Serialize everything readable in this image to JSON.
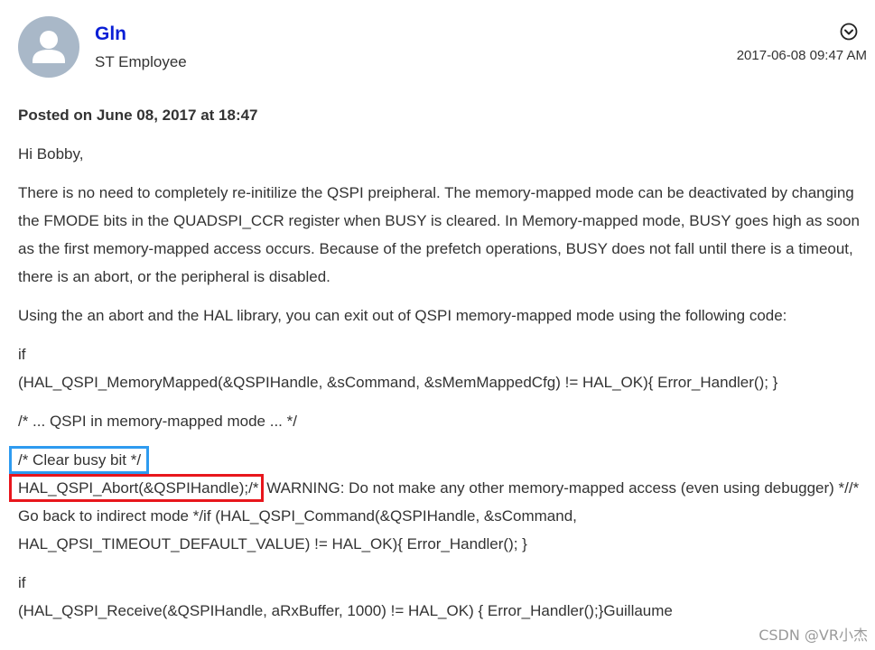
{
  "author": {
    "name": "Gln",
    "role": "ST Employee",
    "avatar_icon": "user-avatar-icon"
  },
  "post": {
    "date": "2017-06-08 09:47 AM",
    "options_icon": "chevron-down-circle-icon",
    "posted_on": "Posted on June 08, 2017 at 18:47",
    "greeting": "Hi Bobby,",
    "para1": "There is no need to completely re-initilize the QSPI preipheral. The memory-mapped mode can be deactivated by changing the FMODE bits in the QUADSPI_CCR register when BUSY is cleared. In Memory-mapped mode, BUSY goes high as soon as the first memory-mapped access occurs. Because of the prefetch operations, BUSY does not fall until there is a timeout, there is an abort, or the peripheral is disabled.",
    "para2": "Using the an abort and the HAL library, you can exit out of QSPI memory-mapped mode using the following code:",
    "code1_if": "if",
    "code1_call": "(HAL_QSPI_MemoryMapped(&QSPIHandle, &sCommand, &sMemMappedCfg) != HAL_OK){   Error_Handler(); }",
    "comment1": "/* ... QSPI in memory-mapped mode ... */",
    "clear_busy": "/* Clear busy bit */",
    "abort_call": "HAL_QSPI_Abort(&QSPIHandle);/*",
    "abort_rest": " WARNING: Do not make any other memory-mapped access (even using debugger) *//* Go back to indirect mode */if (HAL_QSPI_Command(&QSPIHandle, &sCommand, HAL_QPSI_TIMEOUT_DEFAULT_VALUE) != HAL_OK){   Error_Handler(); }",
    "code2_if": "if",
    "code2_call": "(HAL_QSPI_Receive(&QSPIHandle, aRxBuffer, 1000) != HAL_OK) {   Error_Handler();}Guillaume"
  },
  "watermark": "CSDN @VR小杰",
  "colors": {
    "author_name": "#0a1fd6",
    "highlight_blue": "#2e9bf0",
    "highlight_red": "#e8161c",
    "avatar_bg": "#a9b8c8"
  }
}
